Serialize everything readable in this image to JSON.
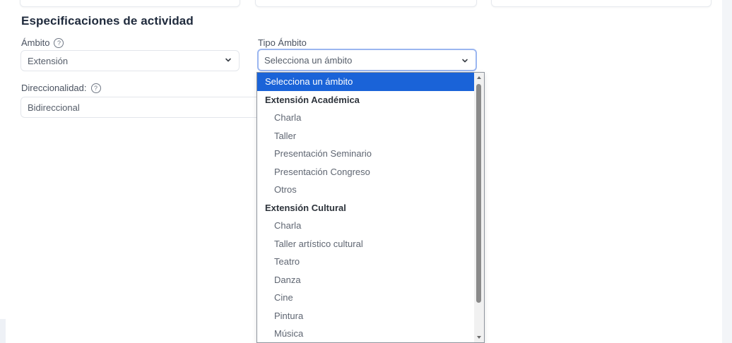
{
  "section": {
    "title": "Especificaciones de actividad"
  },
  "ambito": {
    "label": "Ámbito",
    "value": "Extensión"
  },
  "direccionalidad": {
    "label": "Direccionalidad:",
    "value": "Bidireccional"
  },
  "tipo_ambito": {
    "label": "Tipo Ámbito",
    "value": "Selecciona un ámbito",
    "selected_option": "Selecciona un ámbito",
    "groups": [
      {
        "label": "Extensión Académica",
        "options": [
          "Charla",
          "Taller",
          "Presentación Seminario",
          "Presentación Congreso",
          "Otros"
        ]
      },
      {
        "label": "Extensión Cultural",
        "options": [
          "Charla",
          "Taller artístico cultural",
          "Teatro",
          "Danza",
          "Cine",
          "Pintura",
          "Música"
        ]
      }
    ]
  },
  "help_icon_glyph": "?",
  "colors": {
    "accent": "#1a63d8",
    "focus_border": "#9bb6f0",
    "title": "#1f2a3c"
  }
}
